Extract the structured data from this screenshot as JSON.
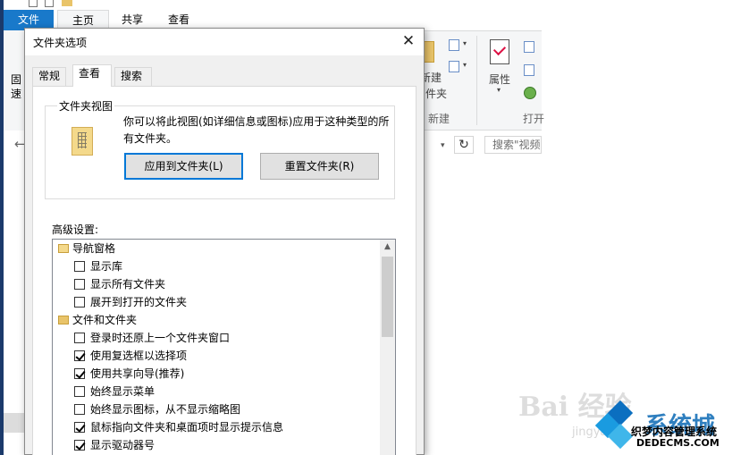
{
  "explorer": {
    "tabs": {
      "file": "文件",
      "home": "主页",
      "share": "共享",
      "view": "查看"
    },
    "ribbon": {
      "pin_line1": "固",
      "pin_line2": "速",
      "new_folder_line1": "新建",
      "new_folder_line2": "件夹",
      "new_group": "新建",
      "properties": "属性",
      "open_group": "打开"
    },
    "search_placeholder": "搜索\"视频"
  },
  "dialog": {
    "title": "文件夹选项",
    "close_glyph": "✕",
    "tabs": [
      "常规",
      "查看",
      "搜索"
    ],
    "active_tab": "查看",
    "folder_views": {
      "legend": "文件夹视图",
      "description": "你可以将此视图(如详细信息或图标)应用于这种类型的所有文件夹。",
      "apply_button": "应用到文件夹(L)",
      "reset_button": "重置文件夹(R)"
    },
    "advanced": {
      "label": "高级设置:",
      "items": [
        {
          "type": "header",
          "text": "导航窗格",
          "icon": "folder-open-icon"
        },
        {
          "type": "checkbox",
          "text": "显示库",
          "checked": false
        },
        {
          "type": "checkbox",
          "text": "显示所有文件夹",
          "checked": false
        },
        {
          "type": "checkbox",
          "text": "展开到打开的文件夹",
          "checked": false
        },
        {
          "type": "header",
          "text": "文件和文件夹",
          "icon": "folder-icon"
        },
        {
          "type": "checkbox",
          "text": "登录时还原上一个文件夹窗口",
          "checked": false
        },
        {
          "type": "checkbox",
          "text": "使用复选框以选择项",
          "checked": true
        },
        {
          "type": "checkbox",
          "text": "使用共享向导(推荐)",
          "checked": true
        },
        {
          "type": "checkbox",
          "text": "始终显示菜单",
          "checked": false
        },
        {
          "type": "checkbox",
          "text": "始终显示图标，从不显示缩略图",
          "checked": false
        },
        {
          "type": "checkbox",
          "text": "鼠标指向文件夹和桌面项时显示提示信息",
          "checked": true
        },
        {
          "type": "checkbox",
          "text": "显示驱动器号",
          "checked": true
        }
      ]
    }
  },
  "watermarks": {
    "baidu": "Bai 经验",
    "baidu_sub": "jingyan",
    "brand": "系统城",
    "line1": "织梦内容管理系统",
    "line2": "DEDECMS.COM"
  },
  "colors": {
    "accent": "#0078d7",
    "file_tab": "#1979ca",
    "folder": "#e9c46a",
    "dialog_bg": "#f0f0f0"
  }
}
